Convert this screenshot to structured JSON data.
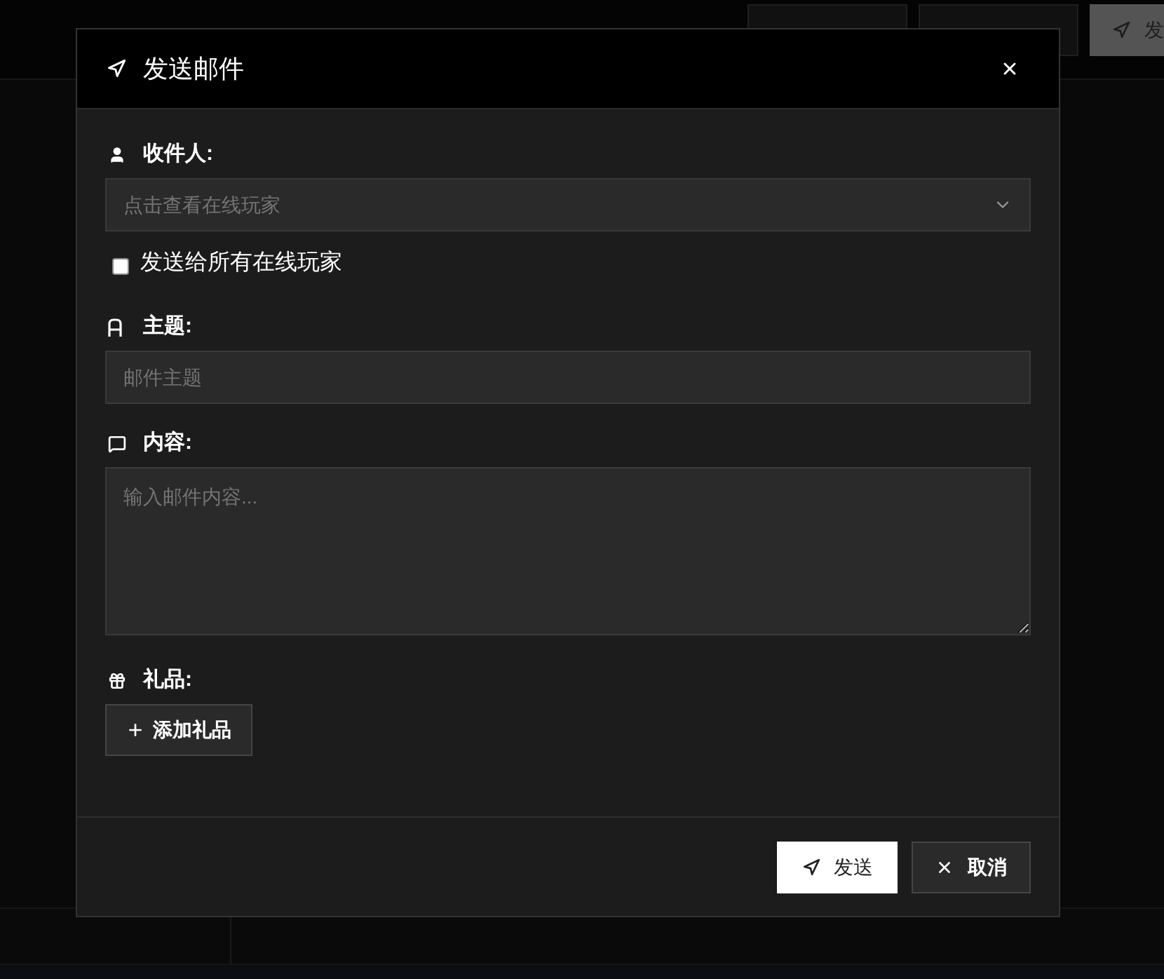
{
  "background_toolbar": {
    "buttons": [
      {
        "kind": "secondary"
      },
      {
        "kind": "secondary"
      },
      {
        "kind": "primary",
        "label": "发"
      }
    ]
  },
  "dialog": {
    "title": "发送邮件",
    "recipient": {
      "label": "收件人:",
      "placeholder": "点击查看在线玩家",
      "send_to_all": {
        "label": "发送给所有在线玩家",
        "checked": false
      }
    },
    "subject": {
      "label": "主题:",
      "placeholder": "邮件主题"
    },
    "content": {
      "label": "内容:",
      "placeholder": "输入邮件内容..."
    },
    "gifts": {
      "label": "礼品:",
      "add_button": "添加礼品"
    },
    "footer_buttons": [
      {
        "kind": "primary",
        "label": "发送"
      },
      {
        "kind": "secondary",
        "label": "取消"
      }
    ]
  }
}
